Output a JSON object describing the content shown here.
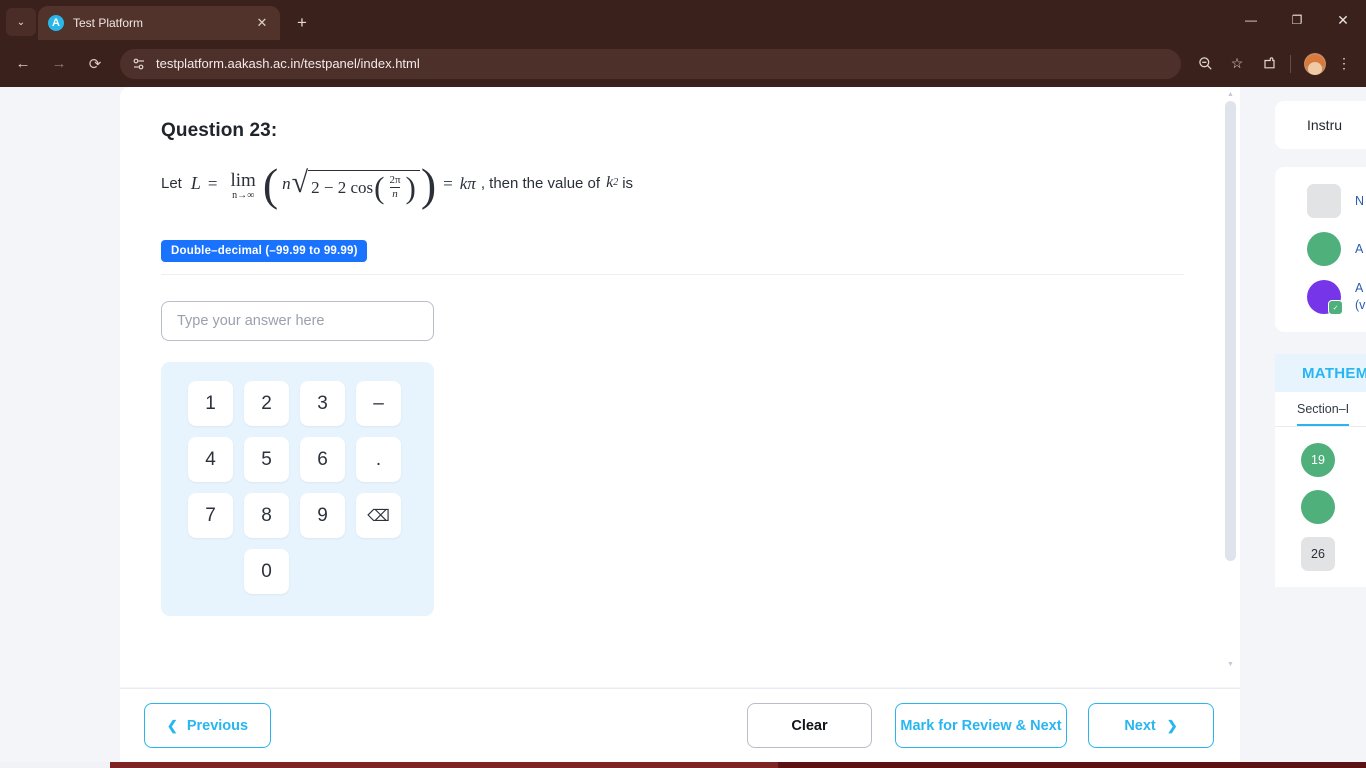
{
  "browser": {
    "tab": {
      "title": "Test Platform",
      "favicon": "aakash-logo-icon",
      "close": "✕"
    },
    "new_tab": "+",
    "tab_search": "⌄",
    "window_controls": {
      "minimize": "—",
      "restore": "❐",
      "close": "✕"
    },
    "nav": {
      "back": "←",
      "forward": "→",
      "reload": "⟳"
    },
    "omnibox": {
      "url": "testplatform.aakash.ac.in/testpanel/index.html",
      "site_info_icon": "site-settings-icon"
    },
    "toolbar_icons": {
      "zoom_out": "⊖",
      "bookmark": "☆",
      "extensions": "⊓",
      "menu": "⋮"
    }
  },
  "question": {
    "title": "Question 23:",
    "prefix": "Let",
    "L": "L",
    "equals": "=",
    "lim": "lim",
    "lim_sub": "n→∞",
    "n_var": "n",
    "radicand_lead": "2 − 2 cos",
    "frac_num": "2π",
    "frac_den": "n",
    "rhs": "kπ",
    "suffix_1": ", then the value of",
    "k_sym": "k",
    "k_power": "2",
    "suffix_2": "is",
    "answer_type_badge": "Double–decimal (–99.99 to 99.99)"
  },
  "answer": {
    "placeholder": "Type your answer here",
    "value": ""
  },
  "keypad": {
    "rows": [
      [
        "1",
        "2",
        "3",
        "–"
      ],
      [
        "4",
        "5",
        "6",
        "."
      ],
      [
        "7",
        "8",
        "9",
        "⌫"
      ],
      [
        "0"
      ]
    ]
  },
  "footer": {
    "previous": "Previous",
    "previous_chevron": "❮",
    "clear": "Clear",
    "mark_review_next": "Mark for Review & Next",
    "next": "Next",
    "next_chevron": "❯"
  },
  "sidebar": {
    "instructions": "Instru",
    "legend": [
      {
        "shape": "square",
        "color": "#e2e3e5",
        "label": "N"
      },
      {
        "shape": "circle",
        "color": "#4fb07c",
        "label": "A"
      },
      {
        "shape": "circle",
        "color": "#7635e8",
        "label": "A",
        "label2": "(v",
        "badge": "answered-badge-icon"
      }
    ],
    "subject": "MATHEM",
    "section_tab": "Section–I",
    "question_numbers": [
      {
        "num": "19",
        "state": "answered"
      },
      {
        "num": "",
        "state": "answered"
      },
      {
        "num": "26",
        "state": "notvisited"
      }
    ]
  },
  "colors": {
    "accent_blue": "#29b6f0",
    "badge_blue": "#1a73ff",
    "answered_green": "#4fb07c",
    "review_purple": "#7635e8",
    "notvisited_gray": "#e2e3e5",
    "chrome_brown": "#3a211c"
  }
}
